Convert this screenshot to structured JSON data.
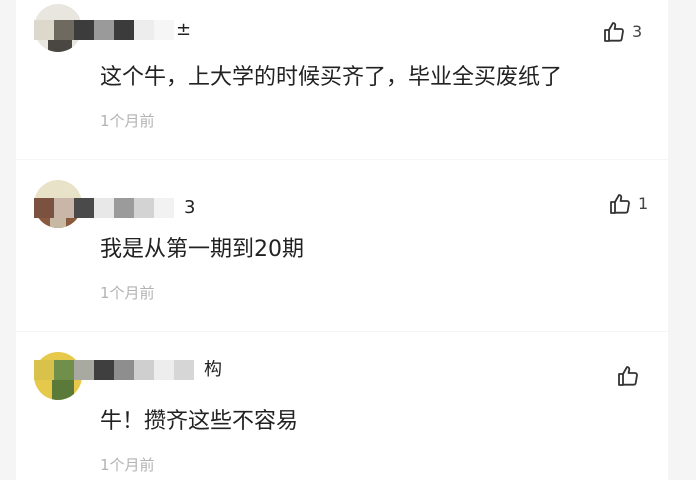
{
  "comments": [
    {
      "username_tail": "±",
      "text": "这个牛，上大学的时候买齐了，毕业全买废纸了",
      "time": "1个月前",
      "likes": "3"
    },
    {
      "username_tail": "3",
      "text": "我是从第一期到20期",
      "time": "1个月前",
      "likes": "1"
    },
    {
      "username_tail": "构",
      "text": "牛！攒齐这些不容易",
      "time": "1个月前",
      "likes": ""
    }
  ],
  "colors": {
    "text": "#222222",
    "timestamp": "#b3b3b3",
    "background": "#f5f5f5",
    "card": "#ffffff"
  },
  "icons": {
    "like": "thumbs-up-icon"
  }
}
